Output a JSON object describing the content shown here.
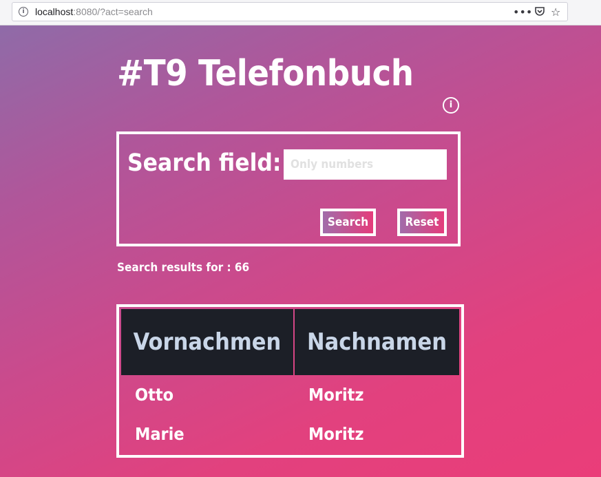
{
  "browser": {
    "url_host": "localhost",
    "url_rest": ":8080/?act=search",
    "menu_icon": "more-dots-icon",
    "pocket_icon": "pocket-icon",
    "bookmark_icon": "bookmark-star-icon"
  },
  "page": {
    "title": "#T9 Telefonbuch",
    "help_icon": "i"
  },
  "search": {
    "label": "Search field:",
    "placeholder": "Only numbers",
    "value": "",
    "search_button": "Search",
    "reset_button": "Reset"
  },
  "results": {
    "label": "Search results for : 66",
    "columns": [
      "Vornachmen",
      "Nachnamen"
    ],
    "rows": [
      [
        "Otto",
        "Moritz"
      ],
      [
        "Marie",
        "Moritz"
      ]
    ]
  },
  "colors": {
    "gradient_start": "#8f6ba8",
    "gradient_end": "#ea3d79",
    "table_header_bg": "#1c1f27",
    "table_header_text": "#c9d6e8"
  }
}
